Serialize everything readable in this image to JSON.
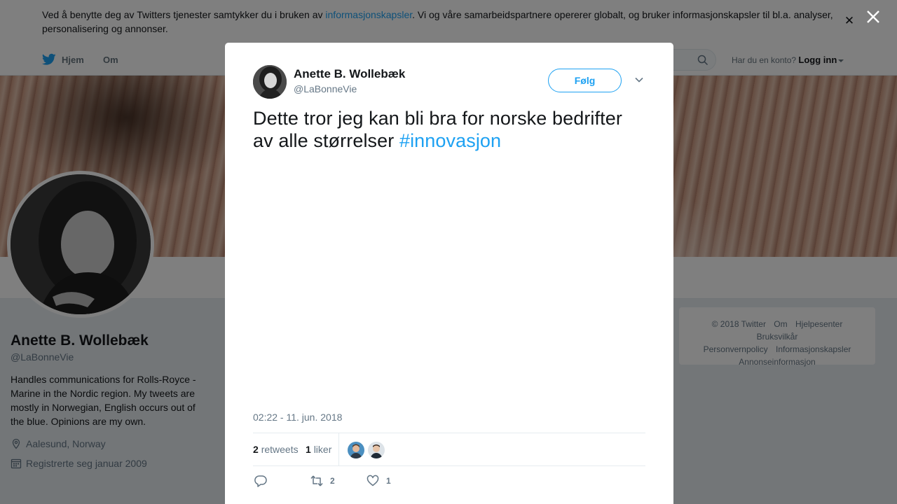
{
  "cookie_banner": {
    "text_before": "Ved å benytte deg av Twitters tjenester samtykker du i bruken av ",
    "link": "informasjonskapsler",
    "text_after": ". Vi og våre samarbeidspartnere opererer globalt, og bruker informasjonskapsler til bl.a. analyser, personalisering og annonser."
  },
  "nav": {
    "home": "Hjem",
    "about": "Om",
    "login_prompt": "Har du en konto?",
    "login": "Logg inn"
  },
  "profile": {
    "name": "Anette B. Wollebæk",
    "handle": "@LaBonneVie",
    "bio": "Handles communications for Rolls-Royce - Marine in the Nordic region. My tweets are mostly in Norwegian, English occurs out of the blue. Opinions are my own.",
    "location": "Aalesund, Norway",
    "joined": "Registrerte seg januar 2009"
  },
  "footer": {
    "links": [
      "© 2018 Twitter",
      "Om",
      "Hjelpesenter",
      "Bruksvilkår",
      "Personvernpolicy",
      "Informasjonskapsler",
      "Annonseinformasjon"
    ]
  },
  "tweet": {
    "author_name": "Anette B. Wollebæk",
    "author_handle": "@LaBonneVie",
    "follow_label": "Følg",
    "text": "Dette tror jeg kan bli bra for norske bedrifter av alle størrelser ",
    "hashtag": "#innovasjon",
    "timestamp": "02:22 - 11. jun. 2018",
    "retweets_count": "2",
    "retweets_label": "retweets",
    "likes_count": "1",
    "likes_label": "liker",
    "action_retweet_count": "2",
    "action_like_count": "1"
  },
  "colors": {
    "accent": "#1da1f2",
    "text": "#14171a",
    "muted": "#657786",
    "like_red": "#e0245e"
  },
  "icons": {
    "nav_logo": "twitter-bird-icon",
    "search": "search-icon",
    "close": "close-icon",
    "location": "location-pin-icon",
    "calendar": "calendar-icon",
    "reply": "reply-icon",
    "retweet": "retweet-icon",
    "like": "heart-icon",
    "more": "chevron-down-icon"
  }
}
